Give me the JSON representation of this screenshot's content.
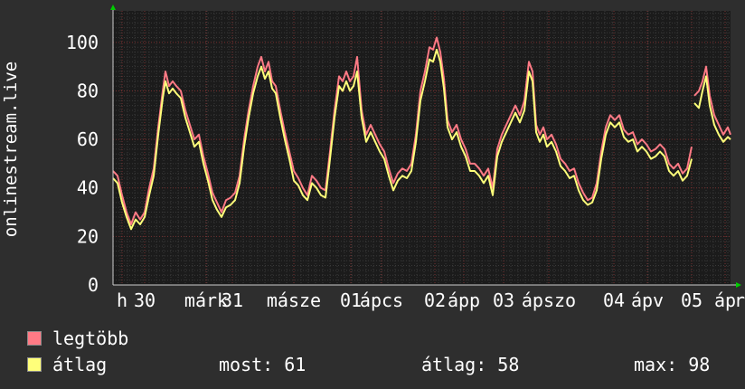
{
  "chart_data": {
    "type": "line",
    "ylabel": "onlinestream.live",
    "ylim": [
      0,
      113
    ],
    "yticks": [
      0,
      20,
      40,
      60,
      80,
      100
    ],
    "xlim": [
      0,
      683
    ],
    "grid": true,
    "xtick_labels": [
      {
        "x": 10,
        "label": "h"
      },
      {
        "x": 35,
        "label": "30"
      },
      {
        "x": 103,
        "label": "márk"
      },
      {
        "x": 132,
        "label": "31"
      },
      {
        "x": 200,
        "label": "másze"
      },
      {
        "x": 263,
        "label": "01"
      },
      {
        "x": 297,
        "label": "ápcs"
      },
      {
        "x": 356,
        "label": "02"
      },
      {
        "x": 388,
        "label": "ápp"
      },
      {
        "x": 432,
        "label": "03"
      },
      {
        "x": 482,
        "label": "ápszo"
      },
      {
        "x": 554,
        "label": "04"
      },
      {
        "x": 591,
        "label": "ápv"
      },
      {
        "x": 640,
        "label": "05"
      },
      {
        "x": 677,
        "label": "áp"
      },
      {
        "x": 693,
        "label": "r"
      }
    ],
    "series": [
      {
        "name": "legtöbb",
        "color": "#ff7a85",
        "values": [
          [
            0,
            47
          ],
          [
            5,
            45
          ],
          [
            10,
            37
          ],
          [
            15,
            30
          ],
          [
            20,
            25
          ],
          [
            25,
            30
          ],
          [
            30,
            27
          ],
          [
            35,
            30
          ],
          [
            40,
            40
          ],
          [
            45,
            48
          ],
          [
            50,
            65
          ],
          [
            55,
            80
          ],
          [
            58,
            88
          ],
          [
            62,
            82
          ],
          [
            66,
            84
          ],
          [
            70,
            82
          ],
          [
            75,
            80
          ],
          [
            80,
            72
          ],
          [
            85,
            66
          ],
          [
            90,
            60
          ],
          [
            95,
            62
          ],
          [
            100,
            53
          ],
          [
            105,
            46
          ],
          [
            110,
            38
          ],
          [
            115,
            34
          ],
          [
            120,
            30
          ],
          [
            125,
            35
          ],
          [
            130,
            36
          ],
          [
            135,
            38
          ],
          [
            140,
            45
          ],
          [
            145,
            60
          ],
          [
            150,
            72
          ],
          [
            155,
            82
          ],
          [
            160,
            90
          ],
          [
            164,
            94
          ],
          [
            168,
            88
          ],
          [
            172,
            92
          ],
          [
            176,
            84
          ],
          [
            180,
            82
          ],
          [
            185,
            72
          ],
          [
            190,
            63
          ],
          [
            195,
            55
          ],
          [
            200,
            47
          ],
          [
            205,
            44
          ],
          [
            210,
            40
          ],
          [
            215,
            37
          ],
          [
            220,
            45
          ],
          [
            225,
            43
          ],
          [
            230,
            40
          ],
          [
            235,
            39
          ],
          [
            240,
            55
          ],
          [
            245,
            72
          ],
          [
            250,
            86
          ],
          [
            254,
            84
          ],
          [
            258,
            88
          ],
          [
            262,
            84
          ],
          [
            266,
            86
          ],
          [
            270,
            94
          ],
          [
            275,
            72
          ],
          [
            280,
            62
          ],
          [
            285,
            66
          ],
          [
            290,
            62
          ],
          [
            295,
            58
          ],
          [
            300,
            55
          ],
          [
            305,
            48
          ],
          [
            310,
            42
          ],
          [
            315,
            46
          ],
          [
            320,
            48
          ],
          [
            325,
            47
          ],
          [
            330,
            50
          ],
          [
            335,
            62
          ],
          [
            340,
            80
          ],
          [
            345,
            88
          ],
          [
            350,
            98
          ],
          [
            354,
            97
          ],
          [
            358,
            102
          ],
          [
            362,
            96
          ],
          [
            366,
            85
          ],
          [
            370,
            68
          ],
          [
            375,
            63
          ],
          [
            380,
            66
          ],
          [
            385,
            60
          ],
          [
            390,
            56
          ],
          [
            395,
            50
          ],
          [
            400,
            50
          ],
          [
            405,
            48
          ],
          [
            410,
            45
          ],
          [
            415,
            48
          ],
          [
            420,
            40
          ],
          [
            425,
            56
          ],
          [
            430,
            62
          ],
          [
            435,
            66
          ],
          [
            440,
            70
          ],
          [
            445,
            74
          ],
          [
            450,
            70
          ],
          [
            455,
            76
          ],
          [
            460,
            92
          ],
          [
            464,
            88
          ],
          [
            468,
            66
          ],
          [
            472,
            62
          ],
          [
            476,
            65
          ],
          [
            480,
            60
          ],
          [
            485,
            62
          ],
          [
            490,
            58
          ],
          [
            495,
            52
          ],
          [
            500,
            50
          ],
          [
            505,
            47
          ],
          [
            510,
            48
          ],
          [
            515,
            42
          ],
          [
            520,
            38
          ],
          [
            525,
            35
          ],
          [
            530,
            36
          ],
          [
            535,
            42
          ],
          [
            540,
            55
          ],
          [
            545,
            65
          ],
          [
            550,
            70
          ],
          [
            555,
            68
          ],
          [
            560,
            70
          ],
          [
            565,
            64
          ],
          [
            570,
            62
          ],
          [
            575,
            63
          ],
          [
            580,
            58
          ],
          [
            585,
            60
          ],
          [
            590,
            58
          ],
          [
            595,
            55
          ],
          [
            600,
            56
          ],
          [
            605,
            58
          ],
          [
            610,
            56
          ],
          [
            615,
            50
          ],
          [
            620,
            48
          ],
          [
            625,
            50
          ],
          [
            630,
            46
          ],
          [
            635,
            48
          ],
          [
            640,
            57
          ],
          null,
          [
            643,
            78
          ],
          [
            648,
            80
          ],
          [
            652,
            84
          ],
          [
            656,
            90
          ],
          [
            660,
            78
          ],
          [
            665,
            70
          ],
          [
            670,
            66
          ],
          [
            675,
            62
          ],
          [
            680,
            65
          ],
          [
            683,
            62
          ]
        ]
      },
      {
        "name": "átlag",
        "color": "#ffff7a",
        "values": [
          [
            0,
            44
          ],
          [
            5,
            42
          ],
          [
            10,
            34
          ],
          [
            15,
            28
          ],
          [
            20,
            23
          ],
          [
            25,
            27
          ],
          [
            30,
            25
          ],
          [
            35,
            28
          ],
          [
            40,
            37
          ],
          [
            45,
            45
          ],
          [
            50,
            62
          ],
          [
            55,
            77
          ],
          [
            58,
            84
          ],
          [
            62,
            79
          ],
          [
            66,
            81
          ],
          [
            70,
            79
          ],
          [
            75,
            77
          ],
          [
            80,
            69
          ],
          [
            85,
            63
          ],
          [
            90,
            57
          ],
          [
            95,
            59
          ],
          [
            100,
            50
          ],
          [
            105,
            43
          ],
          [
            110,
            35
          ],
          [
            115,
            31
          ],
          [
            120,
            28
          ],
          [
            125,
            32
          ],
          [
            130,
            33
          ],
          [
            135,
            35
          ],
          [
            140,
            42
          ],
          [
            145,
            57
          ],
          [
            150,
            69
          ],
          [
            155,
            79
          ],
          [
            160,
            86
          ],
          [
            164,
            90
          ],
          [
            168,
            85
          ],
          [
            172,
            88
          ],
          [
            176,
            81
          ],
          [
            180,
            79
          ],
          [
            185,
            69
          ],
          [
            190,
            60
          ],
          [
            195,
            52
          ],
          [
            200,
            43
          ],
          [
            205,
            41
          ],
          [
            210,
            37
          ],
          [
            215,
            35
          ],
          [
            220,
            42
          ],
          [
            225,
            40
          ],
          [
            230,
            37
          ],
          [
            235,
            36
          ],
          [
            240,
            52
          ],
          [
            245,
            69
          ],
          [
            250,
            82
          ],
          [
            254,
            80
          ],
          [
            258,
            84
          ],
          [
            262,
            80
          ],
          [
            266,
            82
          ],
          [
            270,
            88
          ],
          [
            275,
            69
          ],
          [
            280,
            59
          ],
          [
            285,
            63
          ],
          [
            290,
            59
          ],
          [
            295,
            55
          ],
          [
            300,
            52
          ],
          [
            305,
            45
          ],
          [
            310,
            39
          ],
          [
            315,
            43
          ],
          [
            320,
            45
          ],
          [
            325,
            44
          ],
          [
            330,
            47
          ],
          [
            335,
            59
          ],
          [
            340,
            76
          ],
          [
            345,
            84
          ],
          [
            350,
            93
          ],
          [
            354,
            92
          ],
          [
            358,
            97
          ],
          [
            362,
            92
          ],
          [
            366,
            81
          ],
          [
            370,
            65
          ],
          [
            375,
            60
          ],
          [
            380,
            63
          ],
          [
            385,
            57
          ],
          [
            390,
            53
          ],
          [
            395,
            47
          ],
          [
            400,
            47
          ],
          [
            405,
            45
          ],
          [
            410,
            42
          ],
          [
            415,
            45
          ],
          [
            420,
            37
          ],
          [
            425,
            53
          ],
          [
            430,
            59
          ],
          [
            435,
            63
          ],
          [
            440,
            67
          ],
          [
            445,
            71
          ],
          [
            450,
            67
          ],
          [
            455,
            72
          ],
          [
            460,
            88
          ],
          [
            464,
            84
          ],
          [
            468,
            63
          ],
          [
            472,
            59
          ],
          [
            476,
            62
          ],
          [
            480,
            57
          ],
          [
            485,
            59
          ],
          [
            490,
            55
          ],
          [
            495,
            49
          ],
          [
            500,
            47
          ],
          [
            505,
            44
          ],
          [
            510,
            45
          ],
          [
            515,
            39
          ],
          [
            520,
            35
          ],
          [
            525,
            33
          ],
          [
            530,
            34
          ],
          [
            535,
            39
          ],
          [
            540,
            52
          ],
          [
            545,
            62
          ],
          [
            550,
            67
          ],
          [
            555,
            65
          ],
          [
            560,
            67
          ],
          [
            565,
            61
          ],
          [
            570,
            59
          ],
          [
            575,
            60
          ],
          [
            580,
            55
          ],
          [
            585,
            57
          ],
          [
            590,
            55
          ],
          [
            595,
            52
          ],
          [
            600,
            53
          ],
          [
            605,
            55
          ],
          [
            610,
            53
          ],
          [
            615,
            47
          ],
          [
            620,
            45
          ],
          [
            625,
            47
          ],
          [
            630,
            43
          ],
          [
            635,
            45
          ],
          [
            640,
            52
          ],
          null,
          [
            643,
            75
          ],
          [
            648,
            73
          ],
          [
            652,
            80
          ],
          [
            656,
            86
          ],
          [
            660,
            74
          ],
          [
            665,
            66
          ],
          [
            670,
            62
          ],
          [
            675,
            59
          ],
          [
            680,
            61
          ],
          [
            683,
            60
          ]
        ]
      }
    ]
  },
  "legend": [
    {
      "label": "legtöbb",
      "color": "#ff7a85"
    },
    {
      "label": "átlag",
      "color": "#ffff7a"
    }
  ],
  "stats": {
    "now": "most: 61",
    "avg": "átlag: 58",
    "max": "max: 98"
  }
}
